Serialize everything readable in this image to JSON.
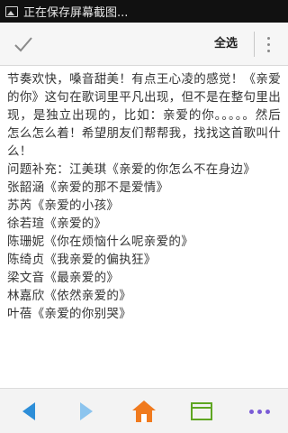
{
  "status_bar": {
    "image_icon": "image-icon",
    "text": "正在保存屏幕截图..."
  },
  "action_bar": {
    "confirm_icon": "check-icon",
    "select_all_label": "全选",
    "overflow_icon": "overflow-menu-icon"
  },
  "content": {
    "intro": "节奏欢快，嗓音甜美！有点王心凌的感觉！《亲爱的你》这句在歌词里平凡出现，但不是在整句里出现，是独立出现的，比如：亲爱的你。。。。。然后怎么怎么着！希望朋友们帮帮我，找找这首歌叫什么！",
    "lines": [
      "问题补充：江美琪《亲爱的你怎么不在身边》",
      "张韶涵《亲爱的那不是爱情》",
      "苏芮《亲爱的小孩》",
      "徐若瑄《亲爱的》",
      "陈珊妮《你在烦恼什么呢亲爱的》",
      "陈绮贞《我亲爱的偏执狂》",
      "梁文音《最亲爱的》",
      "林嘉欣《依然亲爱的》",
      "叶蓓《亲爱的你别哭》"
    ]
  },
  "bottom_bar": {
    "back_icon": "back-arrow-icon",
    "forward_icon": "forward-arrow-icon",
    "home_icon": "home-icon",
    "window_icon": "window-icon",
    "menu_icon": "more-icon",
    "colors": {
      "back": "#2d8ed8",
      "forward": "#8cc4ee",
      "home": "#f07a1e",
      "window": "#5fa622",
      "menu": "#7a5bd6"
    }
  }
}
